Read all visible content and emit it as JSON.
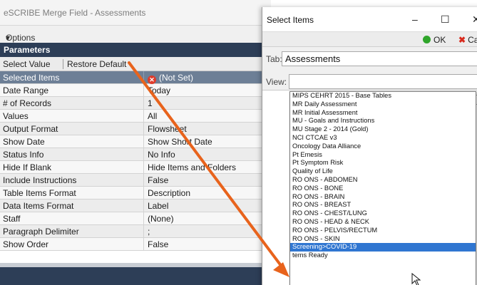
{
  "merge_window": {
    "title": "eSCRIBE Merge Field - Assessments",
    "options_menu": "Options",
    "parameters_header": "Parameters",
    "toolbar": {
      "select_value": "Select Value",
      "restore_default": "Restore Default"
    },
    "rows": [
      {
        "name": "Selected Items",
        "value": "(Not Set)"
      },
      {
        "name": "Date Range",
        "value": "Today"
      },
      {
        "name": "# of Records",
        "value": "1"
      },
      {
        "name": "Values",
        "value": "All"
      },
      {
        "name": "Output Format",
        "value": "Flowsheet"
      },
      {
        "name": "Show Date",
        "value": "Show Short Date"
      },
      {
        "name": "Status Info",
        "value": "No Info"
      },
      {
        "name": "Hide If Blank",
        "value": "Hide Items and Folders"
      },
      {
        "name": "Include Instructions",
        "value": "False"
      },
      {
        "name": "Table Items Format",
        "value": "Description"
      },
      {
        "name": "Data Items Format",
        "value": "Label"
      },
      {
        "name": "Staff",
        "value": "(None)"
      },
      {
        "name": "Paragraph Delimiter",
        "value": ";"
      },
      {
        "name": "Show Order",
        "value": "False"
      }
    ]
  },
  "dialog": {
    "title": "Select Items",
    "minimize_glyph": "–",
    "maximize_glyph": "☐",
    "close_glyph": "✕",
    "ok_label": "OK",
    "cancel_label": "Cancel",
    "tab_label": "Tab:",
    "tab_value": "Assessments",
    "view_label": "View:",
    "view_value": "",
    "list_items": [
      "MIPS CEHRT 2015 - Base Tables",
      "MR Daily Assessment",
      "MR Initial Assessment",
      "MU - Goals and Instructions",
      "MU Stage 2 - 2014 (Gold)",
      "NCI CTCAE v3",
      "Oncology Data Alliance",
      "Pt Emesis",
      "Pt Symptom Risk",
      "Quality of Life",
      "RO ONS - ABDOMEN",
      "RO ONS - BONE",
      "RO ONS - BRAIN",
      "RO ONS - BREAST",
      "RO ONS - CHEST/LUNG",
      "RO ONS - HEAD & NECK",
      "RO ONS - PELVIS/RECTUM",
      "RO ONS - SKIN",
      "Screening>COVID-19",
      "tems Ready"
    ],
    "selected_item": "Screening>COVID-19"
  },
  "colors": {
    "header_navy": "#2d3e57",
    "selected_row": "#6d7f96",
    "highlight_blue": "#3076d1",
    "arrow_orange": "#e8631c",
    "ok_green": "#2fa52a",
    "cancel_red": "#d82a1d"
  },
  "icons": {
    "not_set": "red-x-circle-icon",
    "ok": "green-dot-icon",
    "cancel": "red-x-icon",
    "pointer": "mouse-pointer-icon",
    "annotation": "orange-arrow-icon"
  }
}
